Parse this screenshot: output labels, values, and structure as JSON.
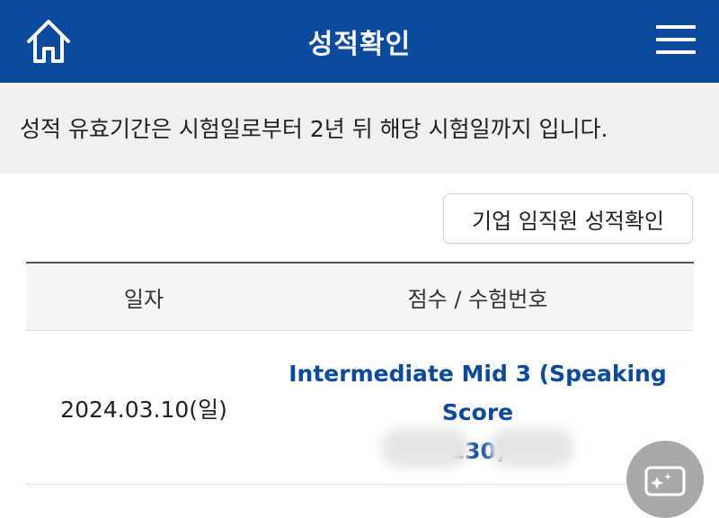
{
  "header": {
    "title": "성적확인",
    "home_icon": "home-icon",
    "menu_icon": "hamburger-menu-icon",
    "background_color": "#0b4a9c"
  },
  "notice": {
    "text": "성적 유효기간은 시험일로부터 2년 뒤 해당 시험일까지 입니다."
  },
  "corporate_button": {
    "label": "기업 임직원 성적확인"
  },
  "table": {
    "columns": [
      "일자",
      "점수 / 수험번호"
    ],
    "rows": [
      {
        "date": "2024.03.10(일)",
        "score_line1": "Intermediate Mid 3 (Speaking Score",
        "score_line2": "130)",
        "exam_number": "blurred"
      }
    ]
  },
  "floating_button": {
    "icon": "sparkle-screen-icon"
  }
}
